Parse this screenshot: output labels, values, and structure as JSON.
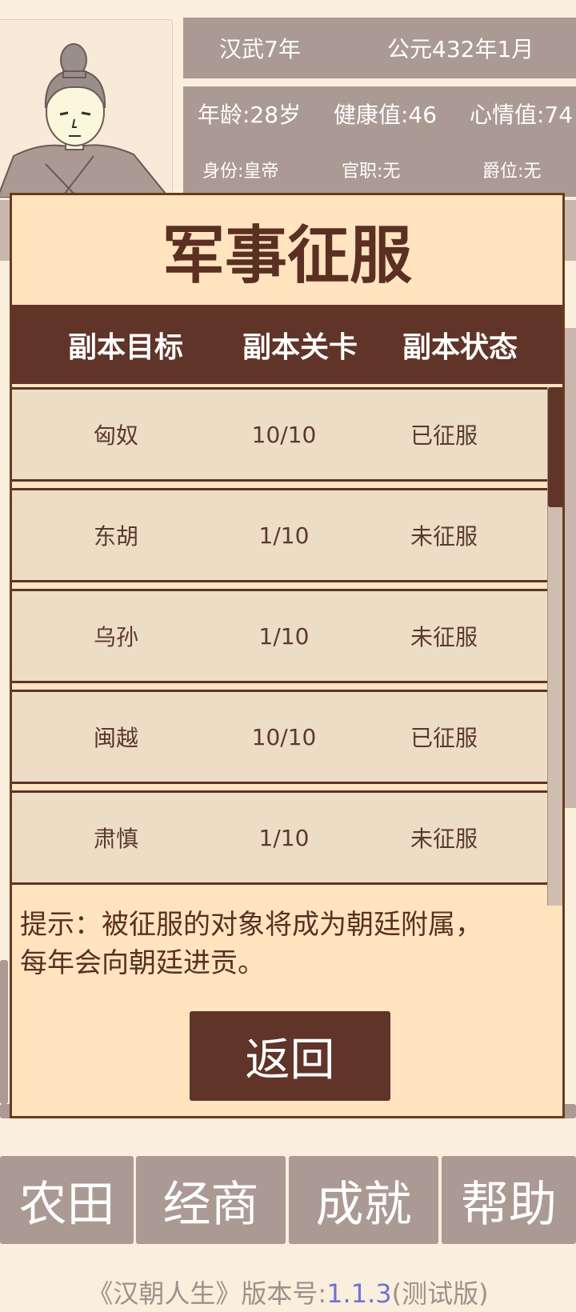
{
  "status": {
    "reign": "汉武7年",
    "date": "公元432年1月",
    "age": "年龄:28岁",
    "health": "健康值:46",
    "mood": "心情值:74",
    "identity": "身份:皇帝",
    "office": "官职:无",
    "title": "爵位:无"
  },
  "dialog": {
    "title": "军事征服",
    "headers": [
      "副本目标",
      "副本关卡",
      "副本状态"
    ],
    "rows": [
      {
        "target": "匈奴",
        "level": "10/10",
        "state": "已征服"
      },
      {
        "target": "东胡",
        "level": "1/10",
        "state": "未征服"
      },
      {
        "target": "乌孙",
        "level": "1/10",
        "state": "未征服"
      },
      {
        "target": "闽越",
        "level": "10/10",
        "state": "已征服"
      },
      {
        "target": "肃慎",
        "level": "1/10",
        "state": "未征服"
      }
    ],
    "tip_line1": "提示：被征服的对象将成为朝廷附属，",
    "tip_line2": "每年会向朝廷进贡。",
    "back_label": "返回"
  },
  "bottom_menu": {
    "farm": "农田",
    "trade": "经商",
    "achievement": "成就",
    "help": "帮助"
  },
  "footer": {
    "prefix": "《汉朝人生》版本号:",
    "version": "1.1.3",
    "suffix": "(测试版)"
  },
  "colors": {
    "dialog_bg": "#ffe4bf",
    "header_bg": "#603429",
    "row_bg": "#eeddc5",
    "tile_bg": "#ab9a93",
    "version_color": "#6f73d8"
  },
  "icons": {
    "avatar": "emperor-portrait"
  }
}
